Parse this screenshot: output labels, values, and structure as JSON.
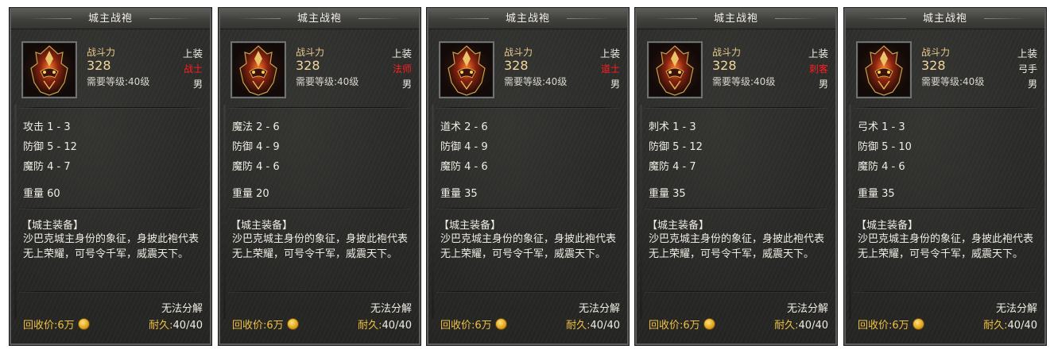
{
  "colors": {
    "class_red": "#ff1e1e",
    "gold": "#f0c040",
    "stat_gold": "#e8c98a"
  },
  "icons": {
    "item": "armor-helmet-icon",
    "coin": "gold-coin-icon"
  },
  "cards": [
    {
      "title": "城主战袍",
      "stat_label": "战斗力",
      "stat_value": "328",
      "requirement": "需要等级:40级",
      "slot": "上装",
      "class": "战士",
      "class_color": "red",
      "gender": "男",
      "attrs": [
        "攻击 1 - 3",
        "防御 5 - 12",
        "魔防 4 - 7"
      ],
      "weight": "重量 60",
      "desc_title": "【城主装备】",
      "desc": "沙巴克城主身份的象征，身披此袍代表无上荣耀，可号令千军，威震天下。",
      "nodecomp": "无法分解",
      "recycle": "回收价:6万",
      "durab_key": "耐久:",
      "durab_val": "40/40"
    },
    {
      "title": "城主战袍",
      "stat_label": "战斗力",
      "stat_value": "328",
      "requirement": "需要等级:40级",
      "slot": "上装",
      "class": "法师",
      "class_color": "red",
      "gender": "男",
      "attrs": [
        "魔法 2 - 6",
        "防御 4 - 9",
        "魔防 4 - 6"
      ],
      "weight": "重量 20",
      "desc_title": "【城主装备】",
      "desc": "沙巴克城主身份的象征，身披此袍代表无上荣耀，可号令千军，威震天下。",
      "nodecomp": "无法分解",
      "recycle": "回收价:6万",
      "durab_key": "耐久:",
      "durab_val": "40/40"
    },
    {
      "title": "城主战袍",
      "stat_label": "战斗力",
      "stat_value": "328",
      "requirement": "需要等级:40级",
      "slot": "上装",
      "class": "道士",
      "class_color": "red",
      "gender": "男",
      "attrs": [
        "道术 2 - 6",
        "防御 4 - 9",
        "魔防 4 - 6"
      ],
      "weight": "重量 35",
      "desc_title": "【城主装备】",
      "desc": "沙巴克城主身份的象征，身披此袍代表无上荣耀，可号令千军，威震天下。",
      "nodecomp": "无法分解",
      "recycle": "回收价:6万",
      "durab_key": "耐久:",
      "durab_val": "40/40"
    },
    {
      "title": "城主战袍",
      "stat_label": "战斗力",
      "stat_value": "328",
      "requirement": "需要等级:40级",
      "slot": "上装",
      "class": "刺客",
      "class_color": "red",
      "gender": "男",
      "attrs": [
        "刺术 1 - 3",
        "防御 5 - 12",
        "魔防 4 - 7"
      ],
      "weight": "重量 35",
      "desc_title": "【城主装备】",
      "desc": "沙巴克城主身份的象征，身披此袍代表无上荣耀，可号令千军，威震天下。",
      "nodecomp": "无法分解",
      "recycle": "回收价:6万",
      "durab_key": "耐久:",
      "durab_val": "40/40"
    },
    {
      "title": "城主战袍",
      "stat_label": "战斗力",
      "stat_value": "328",
      "requirement": "需要等级:40级",
      "slot": "上装",
      "class": "弓手",
      "class_color": "white",
      "gender": "男",
      "attrs": [
        "弓术 1 - 3",
        "防御 5 - 10",
        "魔防 4 - 6"
      ],
      "weight": "重量 35",
      "desc_title": "【城主装备】",
      "desc": "沙巴克城主身份的象征，身披此袍代表无上荣耀，可号令千军，威震天下。",
      "nodecomp": "无法分解",
      "recycle": "回收价:6万",
      "durab_key": "耐久:",
      "durab_val": "40/40"
    }
  ]
}
